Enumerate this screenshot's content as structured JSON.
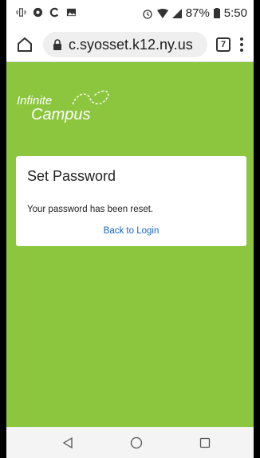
{
  "status": {
    "battery": "87%",
    "time": "5:50"
  },
  "browser": {
    "url": "c.syosset.k12.ny.us",
    "tab_count": "7"
  },
  "brand": {
    "line1": "Infinite",
    "line2": "Campus",
    "color": "#8cc63f"
  },
  "card": {
    "title": "Set Password",
    "message": "Your password has been reset.",
    "link": "Back to Login",
    "link_color": "#1565c0"
  },
  "icons": [
    "vibrate-icon",
    "app-notification-icon",
    "sync-icon",
    "image-icon",
    "alarm-icon",
    "wifi-icon",
    "signal-icon",
    "battery-icon",
    "home-icon",
    "lock-icon",
    "tabs-icon",
    "menu-icon",
    "back-icon",
    "home-circle-icon",
    "recents-icon"
  ]
}
